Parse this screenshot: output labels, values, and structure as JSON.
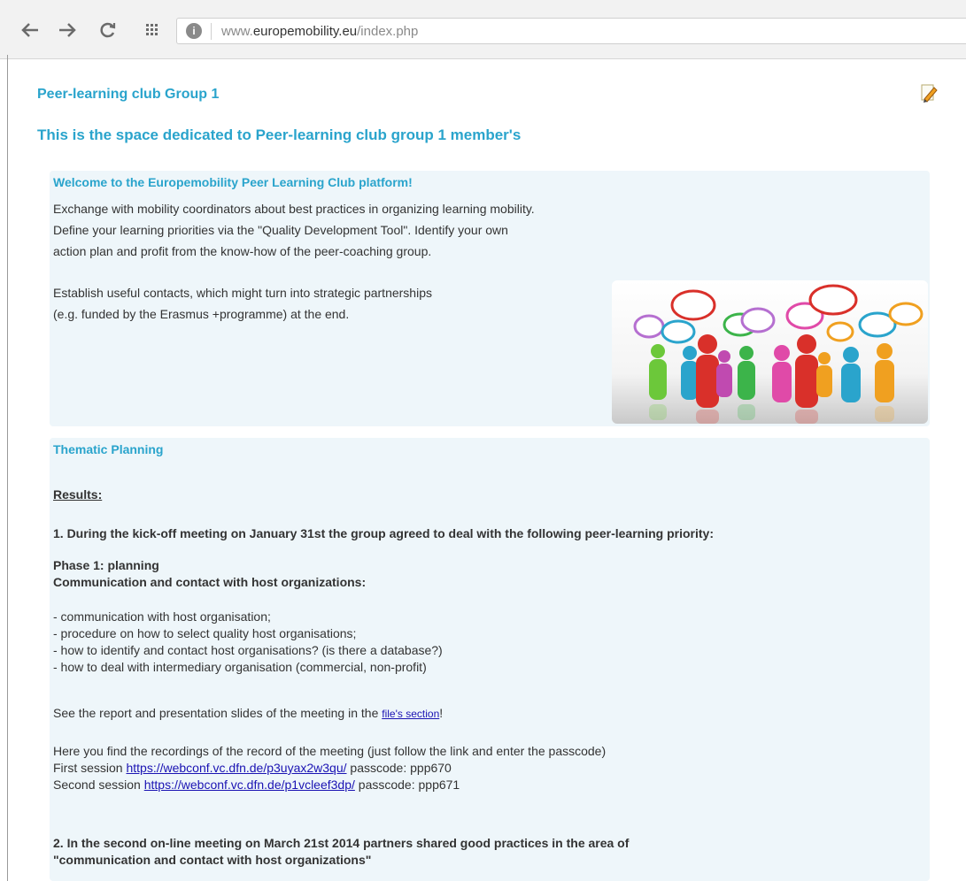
{
  "browser": {
    "url_prefix": "www.",
    "url_domain": "europemobility.eu",
    "url_path": "/index.php"
  },
  "page": {
    "title": "Peer-learning club Group 1",
    "subtitle": "This is the space dedicated to Peer-learning club group 1 member's"
  },
  "welcome": {
    "title": "Welcome to the Europemobility Peer Learning Club platform!",
    "line1": "Exchange with mobility coordinators about best practices in organizing learning mobility.",
    "line2": "Define your learning priorities via the \"Quality Development Tool\". Identify your own",
    "line3": "action plan and profit from the know-how of the peer-coaching group.",
    "line4": "Establish useful contacts, which might turn into strategic partnerships",
    "line5": "(e.g. funded by the Erasmus +programme) at the end."
  },
  "planning": {
    "title": "Thematic Planning",
    "results": "Results:",
    "p1": "1. During the kick-off meeting on January 31st the group agreed to deal with the following peer-learning priority:",
    "phase": "Phase 1: planning",
    "phase_sub": "Communication and contact with host organizations:",
    "bullets": [
      "- communication with host organisation;",
      "- procedure on how to select quality host organisations;",
      "- how to identify and contact host organisations? (is there a database?)",
      "- how to deal with intermediary organisation (commercial, non-profit)"
    ],
    "report_before": "See the report and presentation slides of the meeting in the ",
    "report_link": "file's section",
    "report_after": "!",
    "rec_intro": "Here you find the recordings of the record of the meeting (just follow the link and enter the passcode)",
    "s1_label": "First session ",
    "s1_link": "https://webconf.vc.dfn.de/p3uyax2w3qu/",
    "s1_pass": " passcode: ppp670",
    "s2_label": "Second session ",
    "s2_link": "https://webconf.vc.dfn.de/p1vcleef3dp/",
    "s2_pass": " passcode: ppp671",
    "p2_line1": "2. In the second on-line meeting on March 21st 2014 partners shared good practices in the area of",
    "p2_line2": "\"communication and contact with host organizations\""
  }
}
